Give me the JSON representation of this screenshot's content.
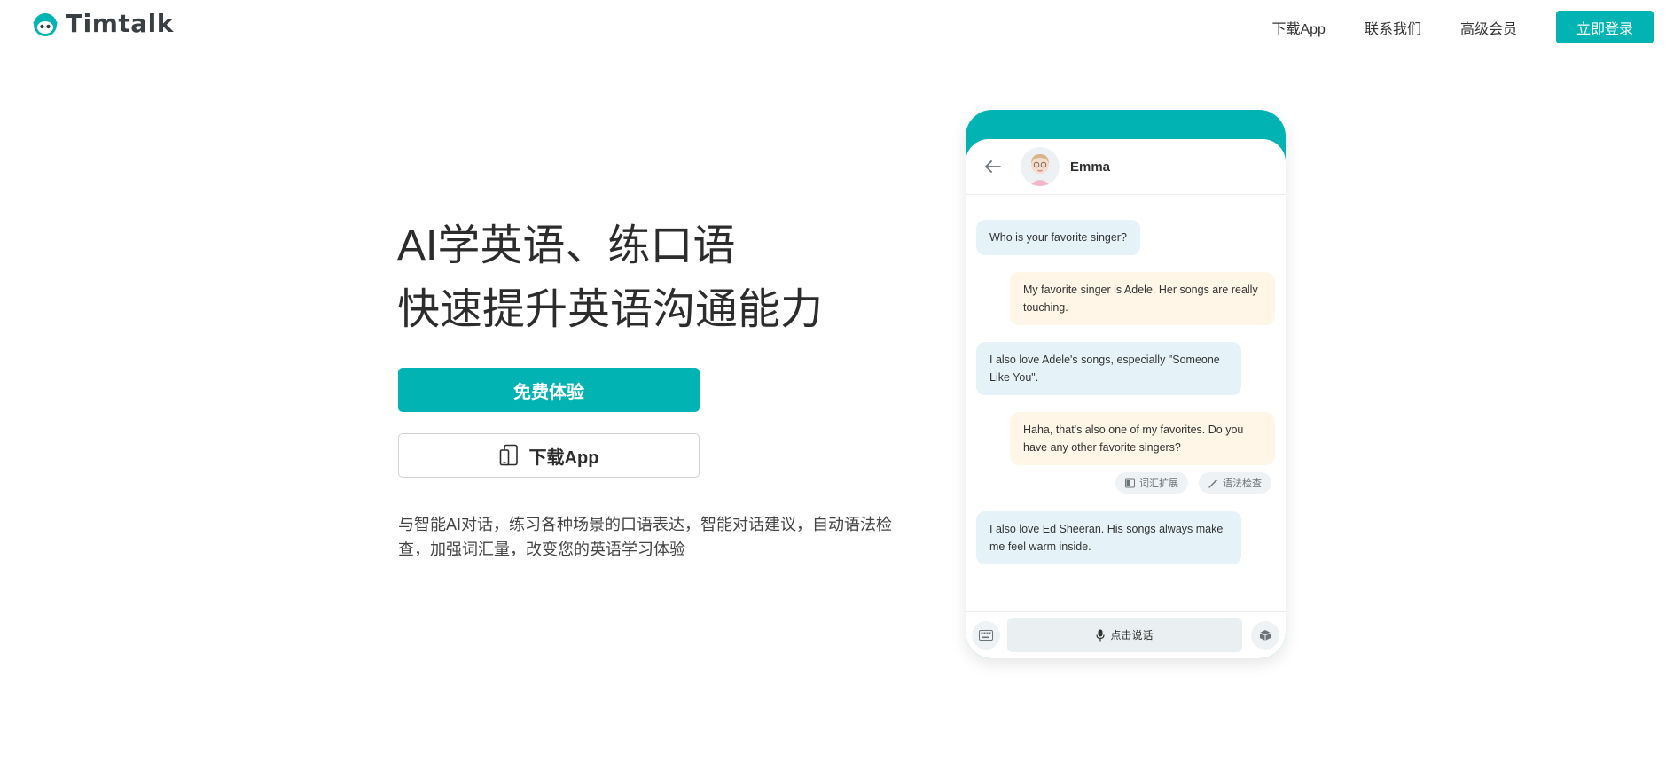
{
  "header": {
    "logo_text": "Timtalk",
    "nav": [
      {
        "label": "下载App"
      },
      {
        "label": "联系我们"
      },
      {
        "label": "高级会员"
      }
    ],
    "login_label": "立即登录"
  },
  "hero": {
    "title_line1": "AI学英语、练口语",
    "title_line2": "快速提升英语沟通能力",
    "primary_button": "免费体验",
    "secondary_button": "下载App",
    "description": "与智能AI对话，练习各种场景的口语表达，智能对话建议，自动语法检查，加强词汇量，改变您的英语学习体验"
  },
  "phone": {
    "contact_name": "Emma",
    "messages": [
      {
        "from": "ai",
        "text": "Who is your favorite singer?"
      },
      {
        "from": "me",
        "text": "My favorite singer is Adele. Her songs are really touching."
      },
      {
        "from": "ai",
        "text": "I also love Adele's songs, especially \"Someone Like You\"."
      },
      {
        "from": "me",
        "text": "Haha, that's also one of my favorites. Do you have any other favorite singers?"
      },
      {
        "from": "ai",
        "text": "I also love Ed Sheeran. His songs always make me feel warm inside."
      }
    ],
    "chips": [
      {
        "label": "词汇扩展",
        "icon": "book-icon"
      },
      {
        "label": "语法检查",
        "icon": "magic-wand-icon"
      }
    ],
    "speak_label": "点击说话"
  },
  "colors": {
    "brand": "#02b3b3",
    "ai_bubble": "#e5f3f9",
    "user_bubble": "#fff6e7"
  }
}
